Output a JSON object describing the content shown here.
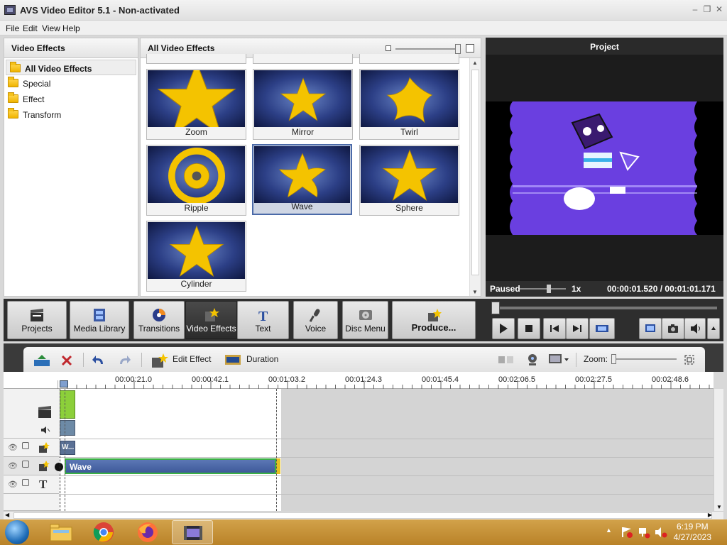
{
  "window": {
    "title": "AVS Video Editor 5.1 - Non-activated"
  },
  "menu": [
    "File",
    "Edit",
    "View",
    "Help"
  ],
  "left_panel": {
    "header": "Video Effects",
    "items": [
      {
        "label": "All Video Effects",
        "selected": true
      },
      {
        "label": "Special"
      },
      {
        "label": "Effect"
      },
      {
        "label": "Transform"
      }
    ]
  },
  "gallery": {
    "header": "All Video Effects",
    "effects": [
      {
        "label": "Zoom"
      },
      {
        "label": "Mirror"
      },
      {
        "label": "Twirl"
      },
      {
        "label": "Ripple"
      },
      {
        "label": "Wave",
        "selected": true
      },
      {
        "label": "Sphere"
      },
      {
        "label": "Cylinder"
      }
    ]
  },
  "preview": {
    "header": "Project",
    "status": "Paused",
    "speed": "1x",
    "time": "00:00:01.520 / 00:01:01.171"
  },
  "toolbar": {
    "projects": "Projects",
    "media_library": "Media Library",
    "transitions": "Transitions",
    "video_effects": "Video Effects",
    "text": "Text",
    "voice": "Voice",
    "disc_menu": "Disc Menu",
    "produce": "Produce..."
  },
  "timeline_toolbar": {
    "edit_effect": "Edit Effect",
    "duration": "Duration",
    "zoom_label": "Zoom:"
  },
  "ruler": [
    "00:00:21.0",
    "00:00:42.1",
    "00:01:03.2",
    "00:01:24.3",
    "00:01:45.4",
    "00:02:06.5",
    "00:02:27.5",
    "00:02:48.6"
  ],
  "timeline": {
    "effect_clip": "Wave",
    "small_clip": "W..."
  },
  "taskbar": {
    "time": "6:19 PM",
    "date": "4/27/2023"
  },
  "colors": {
    "accent": "#4b6aa8",
    "video_bg": "#6a3fe0",
    "effect_clip": "#3e5a9a",
    "clip_green": "#8ccf3a",
    "taskbar": "#c8923a"
  }
}
